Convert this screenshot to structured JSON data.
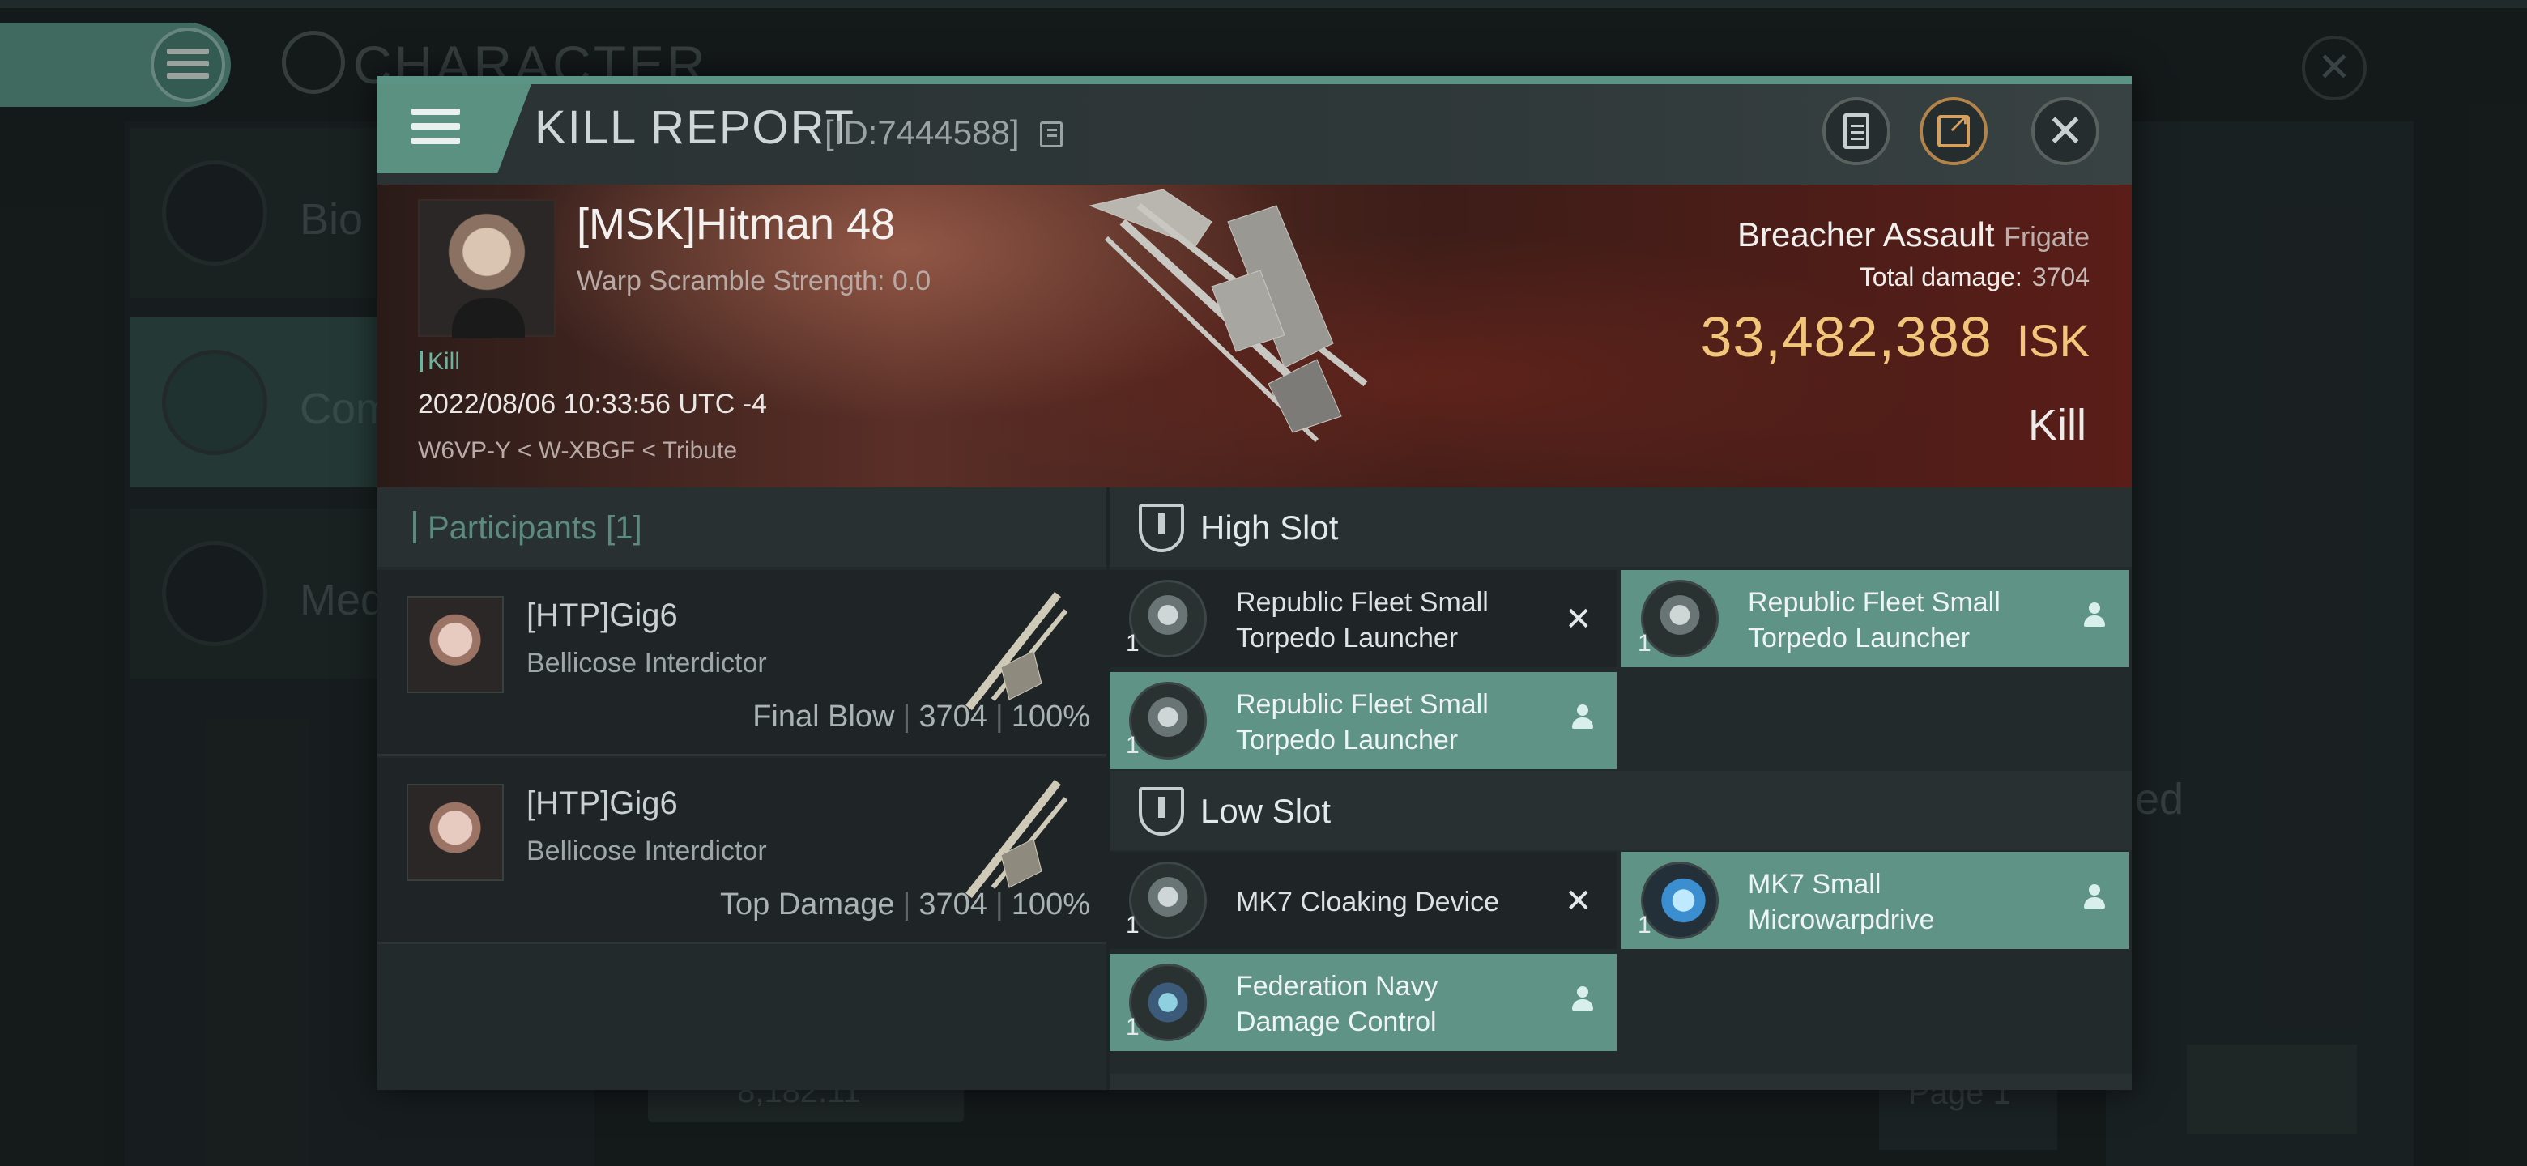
{
  "background": {
    "title": "CHARACTER",
    "sidebar_items": [
      {
        "label": "Bio",
        "icon": "list-icon"
      },
      {
        "label": "Com",
        "icon": "crossed-swords-icon"
      },
      {
        "label": "Med",
        "icon": "star-badge-icon"
      }
    ],
    "right_partial_text": "ed",
    "bottom_value": "8,182.11",
    "page_label": "Page 1"
  },
  "kill_report": {
    "title": "KILL REPORT",
    "id_text": "[ID:7444588]",
    "victim": {
      "name": "[MSK]Hitman 48",
      "warp_scramble": "Warp Scramble Strength: 0.0",
      "tag": "Kill",
      "datetime": "2022/08/06 10:33:56 UTC -4",
      "location": "W6VP-Y < W-XBGF < Tribute"
    },
    "ship": {
      "name": "Breacher Assault",
      "class": "Frigate",
      "total_damage_label": "Total damage:",
      "total_damage": "3704",
      "isk_value": "33,482,388",
      "isk_unit": "ISK",
      "result": "Kill"
    },
    "participants": {
      "title": "Participants [1]",
      "rows": [
        {
          "name": "[HTP]Gig6",
          "ship": "Bellicose Interdictor",
          "role": "Final Blow",
          "damage": "3704",
          "percent": "100%"
        },
        {
          "name": "[HTP]Gig6",
          "ship": "Bellicose Interdictor",
          "role": "Top Damage",
          "damage": "3704",
          "percent": "100%"
        }
      ]
    },
    "fittings": {
      "high_slot": {
        "title": "High Slot",
        "modules": [
          {
            "name": "Republic Fleet Small Torpedo Launcher",
            "qty": "1",
            "status": "destroyed"
          },
          {
            "name": "Republic Fleet Small Torpedo Launcher",
            "qty": "1",
            "status": "dropped"
          },
          {
            "name": "Republic Fleet Small Torpedo Launcher",
            "qty": "1",
            "status": "dropped"
          }
        ]
      },
      "low_slot": {
        "title": "Low Slot",
        "modules": [
          {
            "name": "MK7 Cloaking Device",
            "qty": "1",
            "status": "destroyed"
          },
          {
            "name": "MK7 Small Microwarpdrive",
            "qty": "1",
            "status": "dropped"
          },
          {
            "name": "Federation Navy Damage Control",
            "qty": "1",
            "status": "dropped"
          }
        ]
      }
    },
    "colors": {
      "accent": "#5e9385",
      "isk": "#f1c57a",
      "hero": "#5a2f27"
    }
  }
}
